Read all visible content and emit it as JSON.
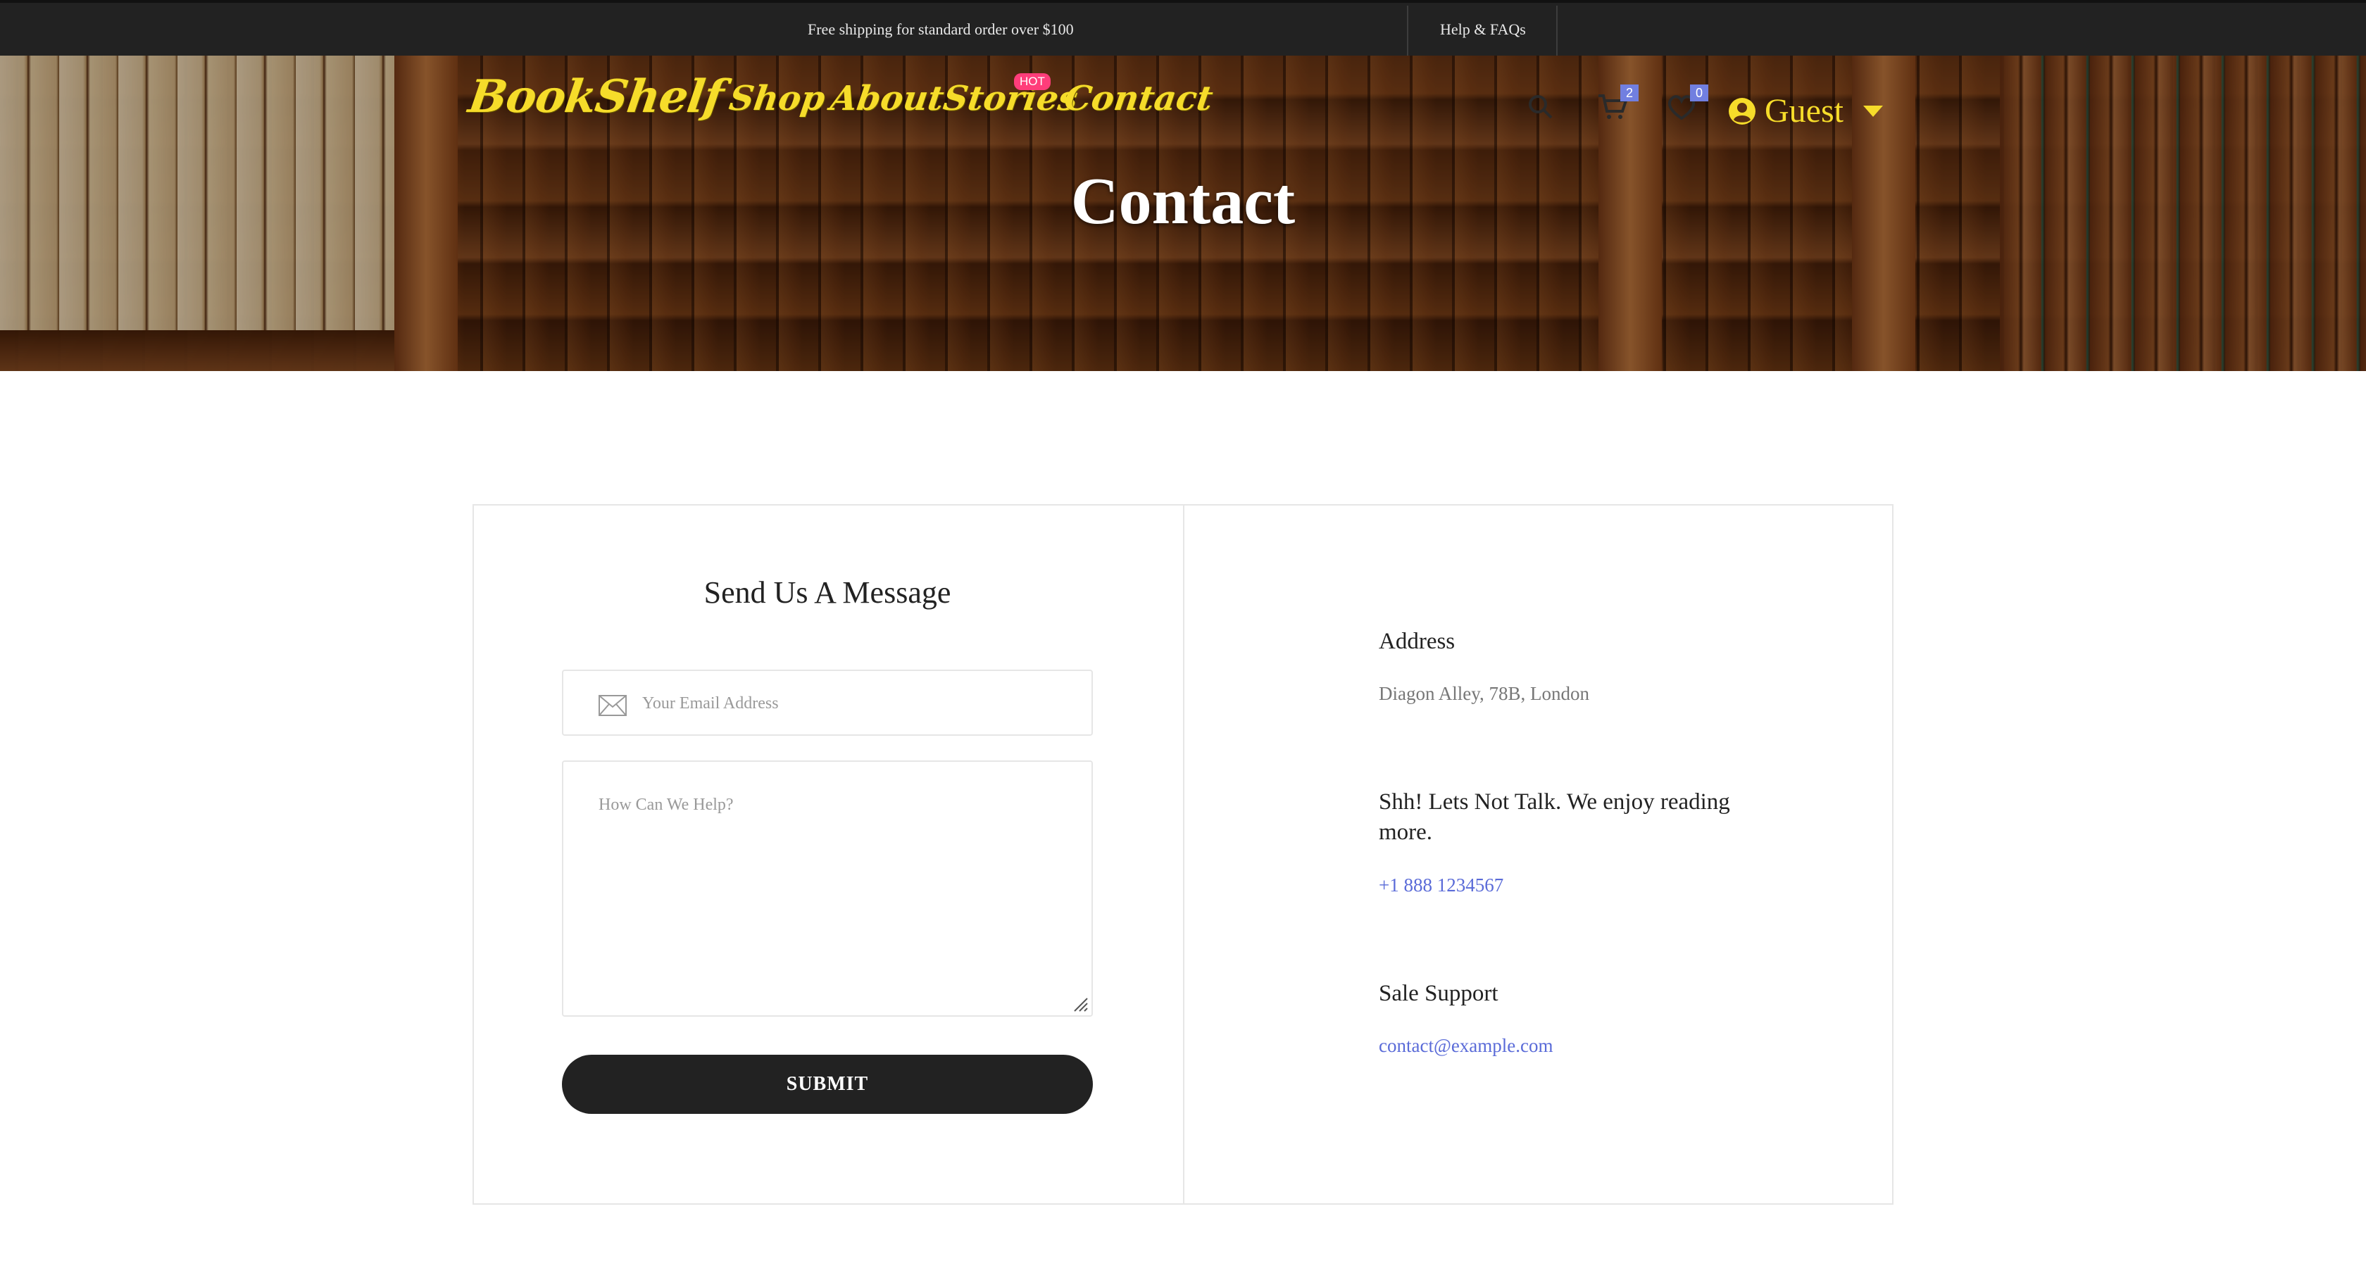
{
  "topbar": {
    "shipping_text": "Free shipping for standard order over $100",
    "help_link": "Help & FAQs"
  },
  "header": {
    "logo": "BookShelf",
    "nav": [
      {
        "label": "Shop"
      },
      {
        "label": "About"
      },
      {
        "label": "Stories",
        "badge": "HOT"
      },
      {
        "label": "Contact"
      }
    ],
    "cart_count": "2",
    "wishlist_count": "0",
    "user_label": "Guest",
    "icons": [
      "search-icon",
      "cart-icon",
      "heart-icon",
      "user-circle-icon",
      "caret-down-icon"
    ],
    "accent_color": "#f6dc2a",
    "badge_color": "#717fe0",
    "hot_color": "#ff3d7a"
  },
  "hero": {
    "title": "Contact"
  },
  "form": {
    "title": "Send Us A Message",
    "email_placeholder": "Your Email Address",
    "email_value": "",
    "message_placeholder": "How Can We Help?",
    "message_value": "",
    "submit_label": "SUBMIT"
  },
  "info": {
    "address_heading": "Address",
    "address_text": "Diagon Alley, 78B, London",
    "talk_heading": "Shh! Lets Not Talk. We enjoy reading more.",
    "phone": "+1 888 1234567",
    "support_heading": "Sale Support",
    "email": "contact@example.com",
    "link_color": "#5a6bd8"
  }
}
